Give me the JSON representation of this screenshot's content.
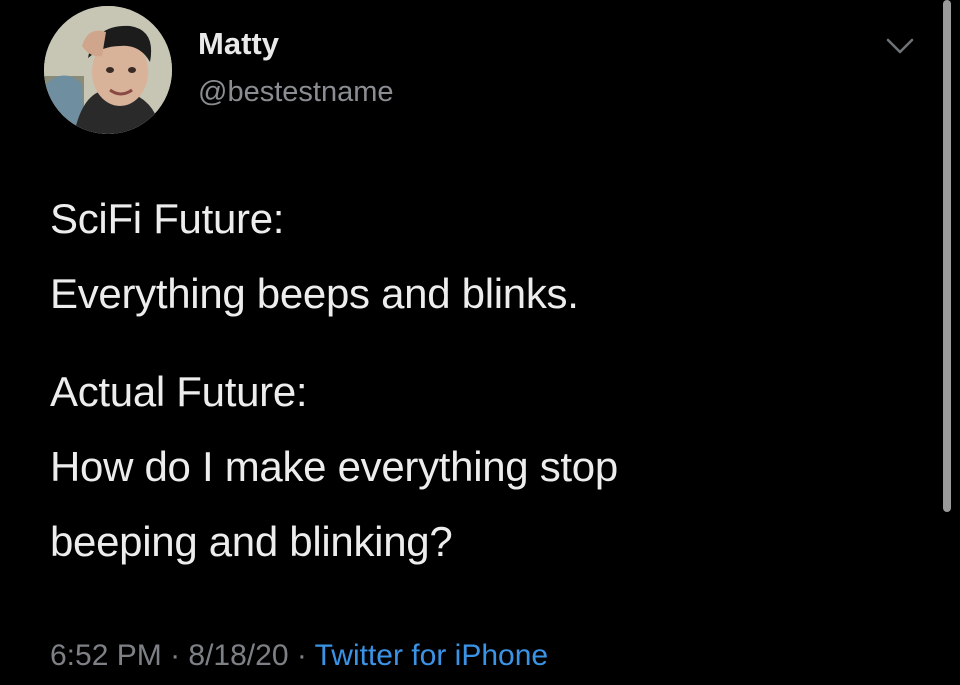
{
  "tweet": {
    "author": {
      "display_name": "Matty",
      "handle": "@bestestname"
    },
    "body_lines": [
      "SciFi Future:",
      "Everything beeps and blinks.",
      "Actual Future:",
      "How do I make everything stop",
      "beeping and blinking?"
    ],
    "meta": {
      "time": "6:52 PM",
      "separator": " · ",
      "date": "8/18/20",
      "source": "Twitter for iPhone"
    },
    "menu_icon": "chevron-down-icon"
  },
  "colors": {
    "background": "#000000",
    "text": "#ededed",
    "secondary": "#7d8186",
    "link": "#3b93e6"
  }
}
